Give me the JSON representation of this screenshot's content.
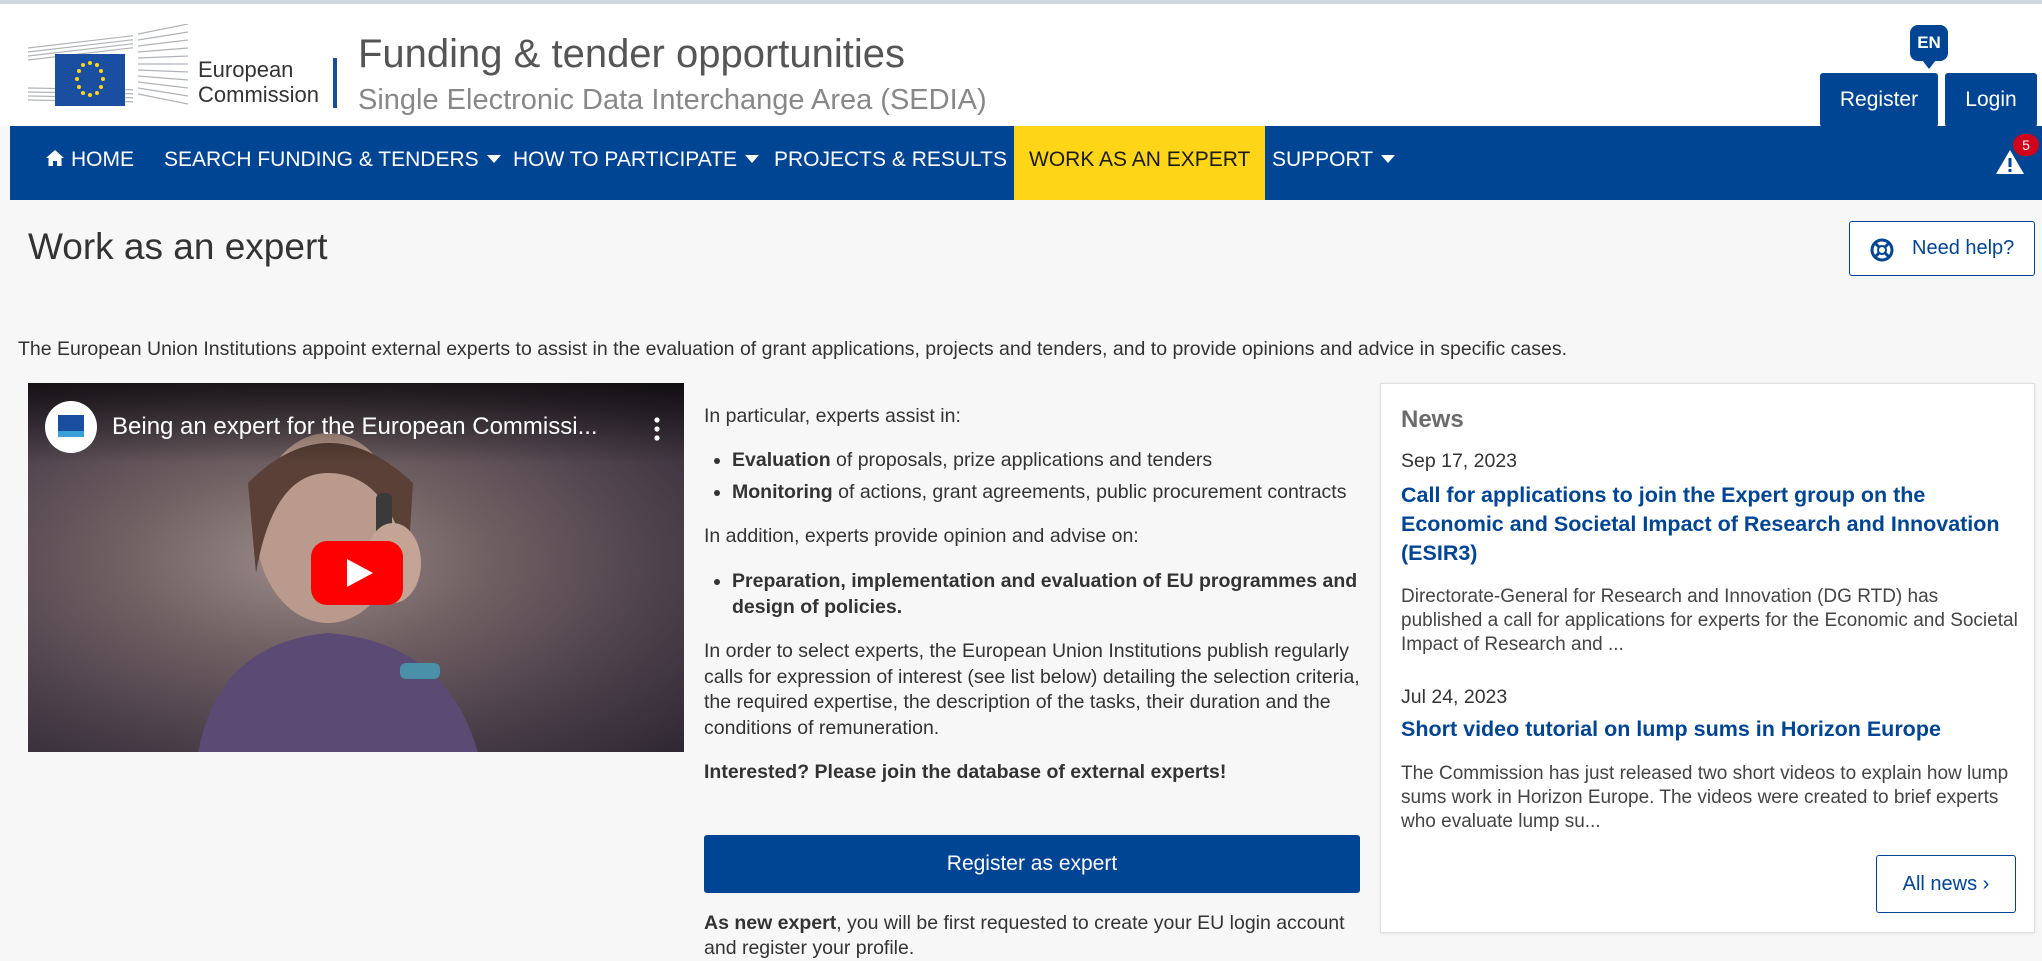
{
  "header": {
    "logo_line1": "European",
    "logo_line2": "Commission",
    "title": "Funding & tender opportunities",
    "subtitle": "Single Electronic Data Interchange Area (SEDIA)",
    "language": "EN",
    "register_label": "Register",
    "login_label": "Login"
  },
  "nav": {
    "items": [
      {
        "label": "HOME",
        "icon": "home-icon"
      },
      {
        "label": "SEARCH FUNDING & TENDERS",
        "dropdown": true
      },
      {
        "label": "HOW TO PARTICIPATE",
        "dropdown": true
      },
      {
        "label": "PROJECTS & RESULTS"
      },
      {
        "label": "WORK AS AN EXPERT",
        "active": true
      },
      {
        "label": "SUPPORT",
        "dropdown": true
      }
    ],
    "alert_count": "5"
  },
  "page": {
    "title": "Work as an expert",
    "need_help_label": "Need help?",
    "intro": "The European Union Institutions appoint external experts to assist in the evaluation of grant applications, projects and tenders, and to provide opinions and advice in specific cases."
  },
  "video": {
    "title": "Being an expert for the European Commissi..."
  },
  "content": {
    "assist_intro": "In particular, experts assist in:",
    "assist_items": [
      {
        "bold": "Evaluation",
        "rest": " of proposals, prize applications and tenders"
      },
      {
        "bold": "Monitoring",
        "rest": " of actions, grant agreements, public procurement contracts"
      }
    ],
    "advise_intro": "In addition, experts provide opinion and advise on:",
    "advise_item": "Preparation, implementation and evaluation of EU programmes and design of policies.",
    "selection_text": "In order to select experts, the European Union Institutions publish regularly calls for expression of interest (see list below) detailing the selection criteria, the required expertise, the description of the tasks, their duration and the conditions of remuneration.",
    "interested": "Interested? Please join the database of external experts!",
    "register_expert_label": "Register as expert",
    "new_expert_bold": "As new expert",
    "new_expert_rest": ", you will be first requested to create your EU login account and register your profile."
  },
  "news": {
    "heading": "News",
    "items": [
      {
        "date": "Sep 17, 2023",
        "title": "Call for applications to join the Expert group on the Economic and Societal Impact of Research and Innovation (ESIR3)",
        "body": "Directorate-General for Research and Innovation (DG RTD) has published a call for applications for experts for the Economic and Societal Impact of Research and ..."
      },
      {
        "date": "Jul 24, 2023",
        "title": "Short video tutorial on lump sums in Horizon Europe",
        "body": "The Commission has just released two short videos to explain how lump sums work in Horizon Europe. The videos were created to brief experts who evaluate lump su..."
      }
    ],
    "all_news_label": "All news ›"
  },
  "colors": {
    "primary": "#004494",
    "active_nav": "#ffd617",
    "alert": "#d0021b"
  }
}
